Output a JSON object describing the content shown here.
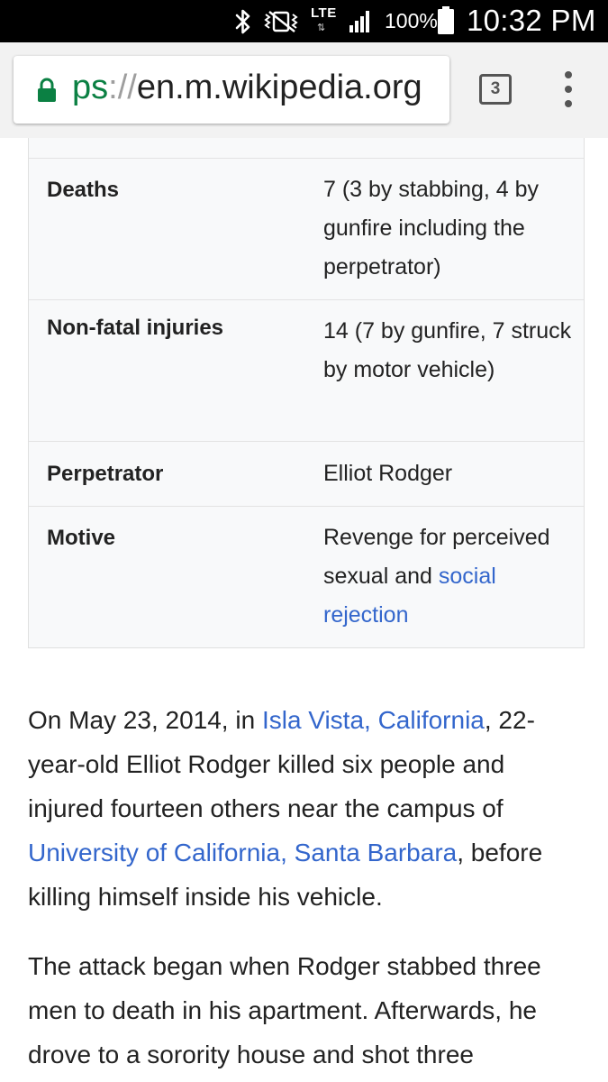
{
  "status_bar": {
    "bluetooth_icon": "bluetooth-icon",
    "vibrate_icon": "vibrate-icon",
    "network": "LTE",
    "signal_icon": "signal-icon",
    "battery_percent": "100%",
    "battery_icon": "battery-icon",
    "time": "10:32 PM"
  },
  "browser": {
    "url_scheme": "ps",
    "url_sep": "://",
    "url_host": "en.m.wikipedia.org",
    "lock_icon": "lock-icon",
    "tab_count": "3",
    "menu_icon": "overflow-menu-icon",
    "colors": {
      "secure": "#0b8043",
      "toolbar_bg": "#f2f2f2"
    }
  },
  "infobox": {
    "rows": [
      {
        "label": "Deaths",
        "value": "7 (3 by stabbing, 4 by gunfire including the perpetrator)"
      },
      {
        "label": "Non-fatal injuries",
        "value": "14 (7 by gunfire, 7 struck by motor vehicle)"
      },
      {
        "label": "Perpetrator",
        "value": "Elliot Rodger"
      },
      {
        "label": "Motive",
        "value_text": "Revenge for perceived sexual and ",
        "value_link": "social rejection"
      }
    ]
  },
  "article": {
    "p1": {
      "t1": "On May 23, 2014, in ",
      "link1": "Isla Vista, California",
      "t2": ", 22-year-old Elliot Rodger killed six people and injured fourteen others near the campus of ",
      "link2": "University of California, Santa Barbara",
      "t3": ", before killing himself inside his vehicle."
    },
    "p2": "The attack began when Rodger stabbed three men to death in his apartment. Afterwards, he drove to a sorority house and shot three"
  },
  "colors": {
    "link": "#3366cc",
    "text": "#222222",
    "infobox_bg": "#f8f9fa"
  }
}
